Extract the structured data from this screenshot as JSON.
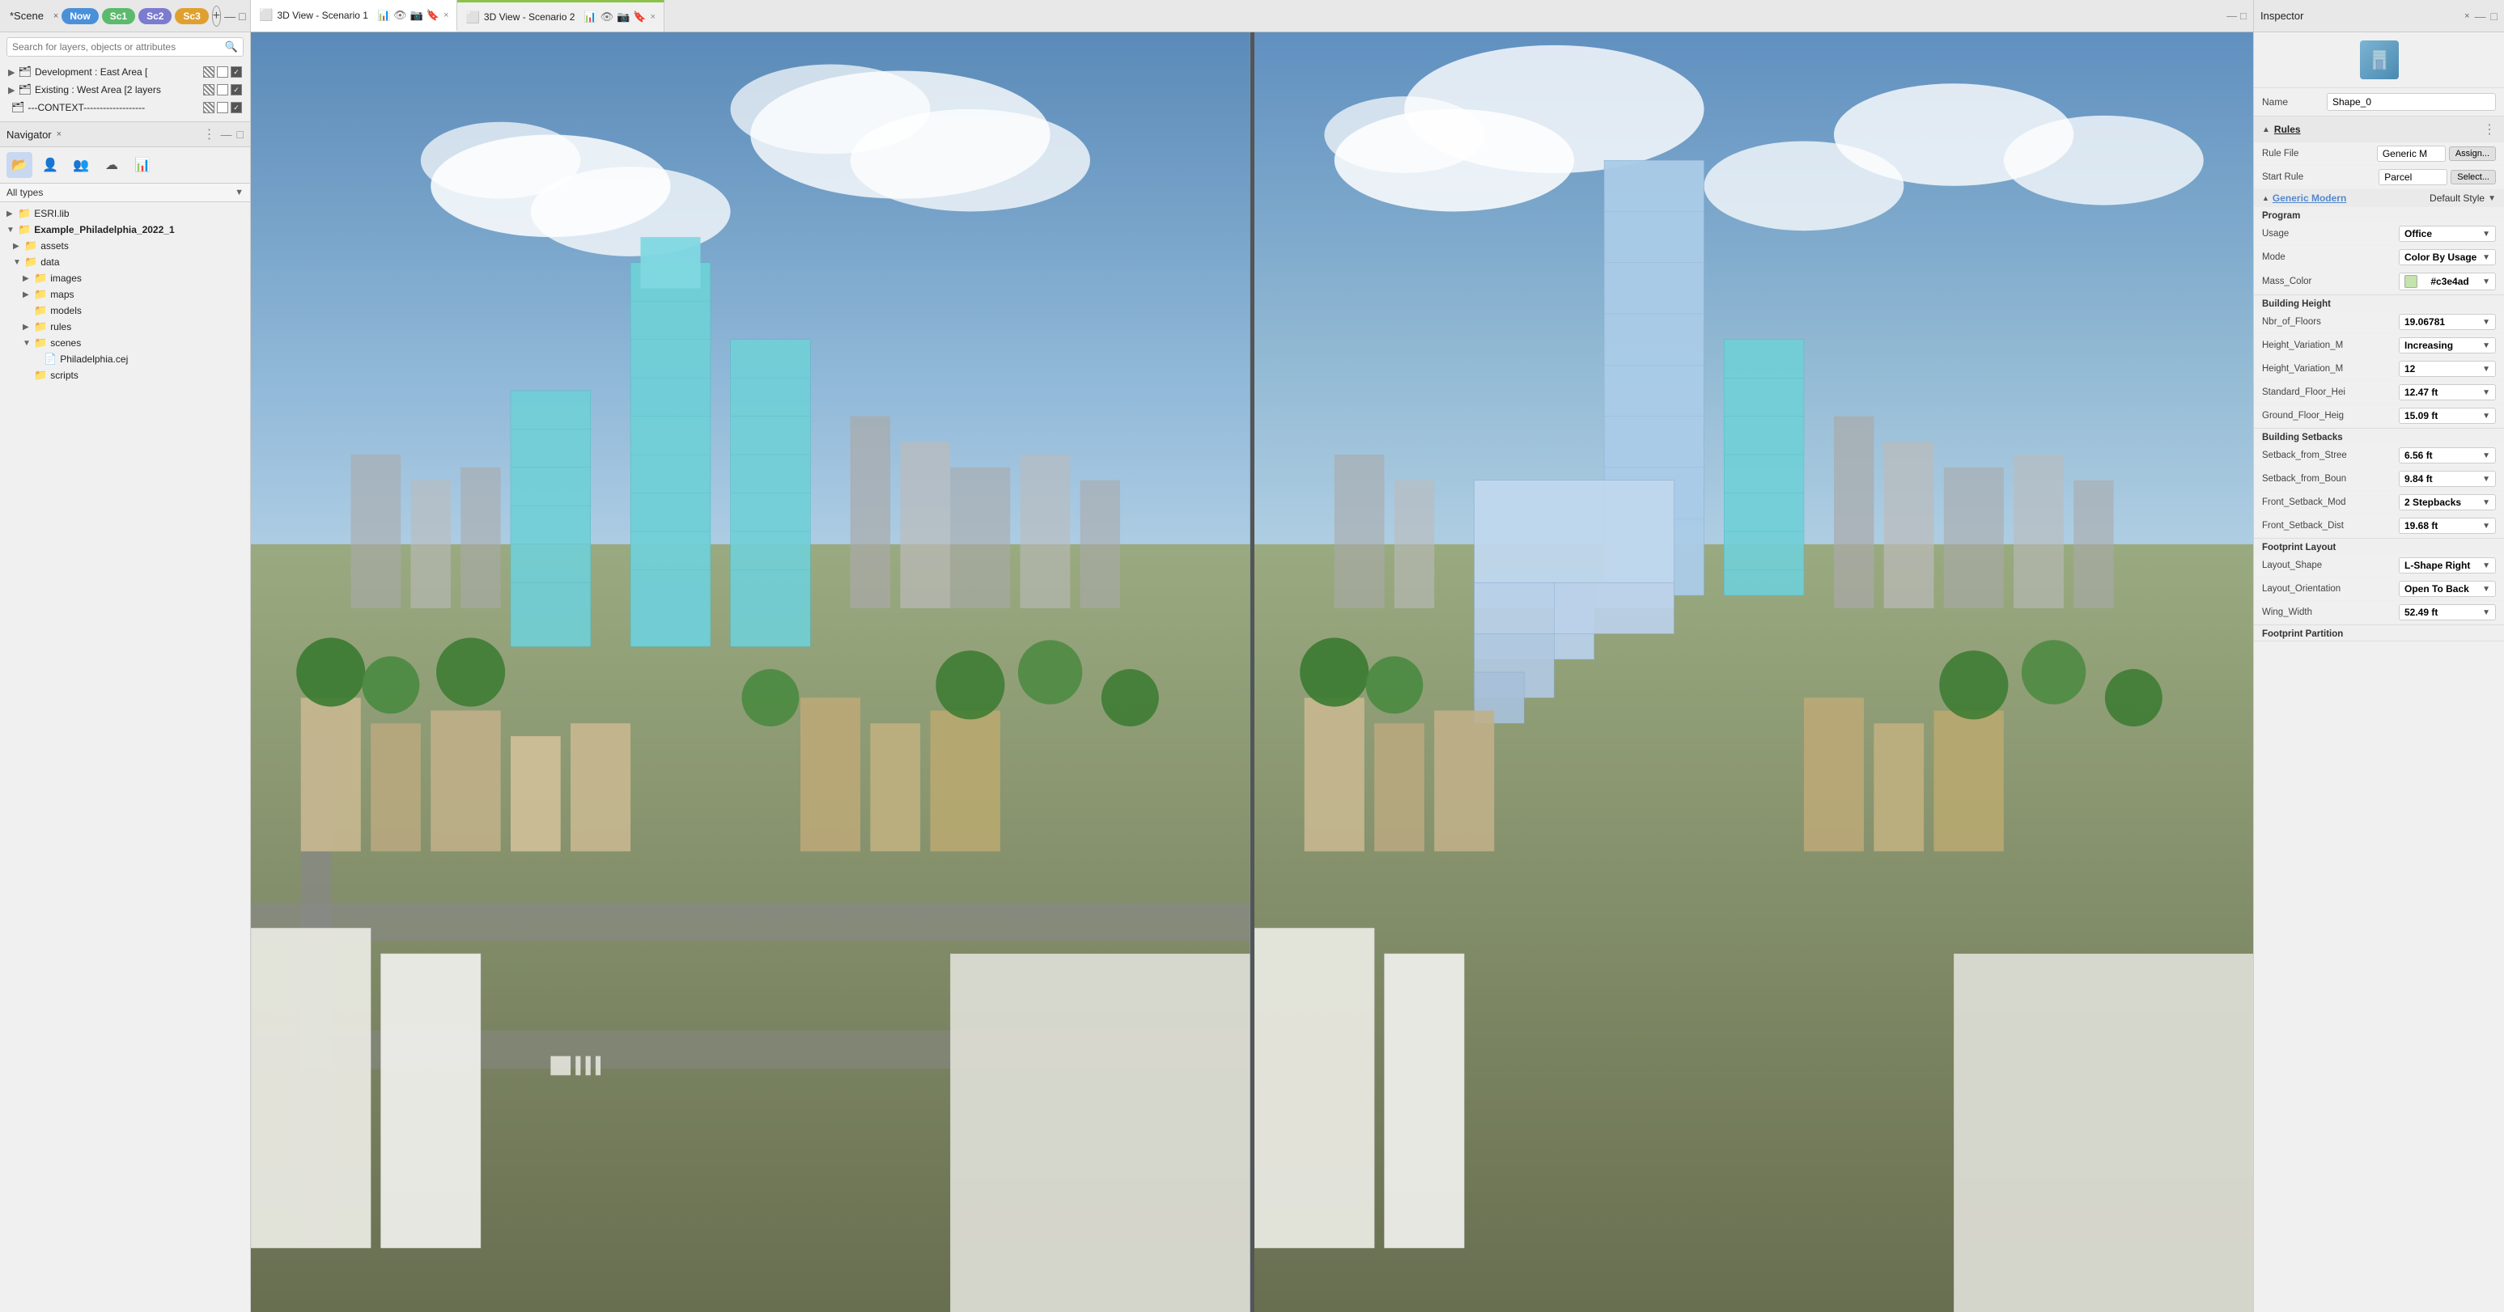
{
  "app": {
    "title": "*Scene",
    "scene_close": "×"
  },
  "scene_tabs": {
    "now_label": "Now",
    "sc1_label": "Sc1",
    "sc2_label": "Sc2",
    "sc3_label": "Sc3",
    "add_label": "+"
  },
  "layers": {
    "search_placeholder": "Search for layers, objects or attributes",
    "items": [
      {
        "name": "Development : East Area [",
        "indent": 0,
        "has_toggle": true,
        "toggle": "▶"
      },
      {
        "name": "Existing : West Area [2 layers",
        "indent": 0,
        "has_toggle": true,
        "toggle": "▶"
      },
      {
        "name": "---CONTEXT-------------------",
        "indent": 0,
        "has_toggle": false
      }
    ]
  },
  "navigator": {
    "title": "Navigator",
    "close": "×",
    "type_filter": "All types",
    "tree": [
      {
        "name": "ESRI.lib",
        "indent": 0,
        "toggle": "▶",
        "icon": "📁",
        "bold": false
      },
      {
        "name": "Example_Philadelphia_2022_1",
        "indent": 0,
        "toggle": "▼",
        "icon": "📁",
        "bold": true
      },
      {
        "name": "assets",
        "indent": 1,
        "toggle": "▶",
        "icon": "📁",
        "bold": false
      },
      {
        "name": "data",
        "indent": 1,
        "toggle": "▶",
        "icon": "📁",
        "bold": false
      },
      {
        "name": "images",
        "indent": 2,
        "toggle": "▶",
        "icon": "📁",
        "bold": false
      },
      {
        "name": "maps",
        "indent": 2,
        "toggle": "▶",
        "icon": "📁",
        "bold": false
      },
      {
        "name": "models",
        "indent": 2,
        "toggle": "",
        "icon": "📁",
        "bold": false
      },
      {
        "name": "rules",
        "indent": 2,
        "toggle": "▶",
        "icon": "📁",
        "bold": false
      },
      {
        "name": "scenes",
        "indent": 2,
        "toggle": "▼",
        "icon": "📁",
        "bold": false
      },
      {
        "name": "Philadelphia.cej",
        "indent": 3,
        "toggle": "",
        "icon": "📄",
        "bold": false
      },
      {
        "name": "scripts",
        "indent": 2,
        "toggle": "",
        "icon": "📁",
        "bold": false
      }
    ]
  },
  "views": {
    "tab1": {
      "icon": "⬜",
      "title": "3D View - Scenario 1",
      "close": "×"
    },
    "tab2": {
      "icon": "⬜",
      "title": "3D View - Scenario 2",
      "close": "×"
    }
  },
  "inspector": {
    "title": "Inspector",
    "close": "×",
    "name_label": "Name",
    "name_value": "Shape_0",
    "sections": {
      "rules": {
        "title": "Rules",
        "rule_file_label": "Rule File",
        "rule_file_value": "Generic M",
        "assign_btn": "Assign...",
        "start_rule_label": "Start Rule",
        "start_rule_value": "Parcel",
        "select_btn": "Select...",
        "subsection_title": "Generic Modern",
        "subsection_style": "Default Style"
      },
      "program": {
        "title": "Program",
        "usage_label": "Usage",
        "usage_value": "Office",
        "mode_label": "Mode",
        "mode_value": "Color By Usage",
        "mass_color_label": "Mass_Color",
        "mass_color_value": "#c3e4ad",
        "mass_color_hex": "#c3e4ad"
      },
      "building_height": {
        "title": "Building Height",
        "nbr_floors_label": "Nbr_of_Floors",
        "nbr_floors_value": "19.06781",
        "height_var_m_label": "Height_Variation_M",
        "height_var_m_value": "Increasing",
        "height_var_m2_label": "Height_Variation_M",
        "height_var_m2_value": "12",
        "std_floor_label": "Standard_Floor_Hei",
        "std_floor_value": "12.47 ft",
        "ground_floor_label": "Ground_Floor_Heig",
        "ground_floor_value": "15.09 ft"
      },
      "building_setbacks": {
        "title": "Building Setbacks",
        "setback_street_label": "Setback_from_Stree",
        "setback_street_value": "6.56 ft",
        "setback_bound_label": "Setback_from_Boun",
        "setback_bound_value": "9.84 ft",
        "front_mod_label": "Front_Setback_Mod",
        "front_mod_value": "2 Stepbacks",
        "front_dist_label": "Front_Setback_Dist",
        "front_dist_value": "19.68 ft"
      },
      "footprint_layout": {
        "title": "Footprint Layout",
        "layout_shape_label": "Layout_Shape",
        "layout_shape_value": "L-Shape Right",
        "layout_orient_label": "Layout_Orientation",
        "layout_orient_value": "Open To Back",
        "wing_width_label": "Wing_Width",
        "wing_width_value": "52.49 ft"
      },
      "footprint_partition": {
        "title": "Footprint Partition"
      }
    }
  }
}
